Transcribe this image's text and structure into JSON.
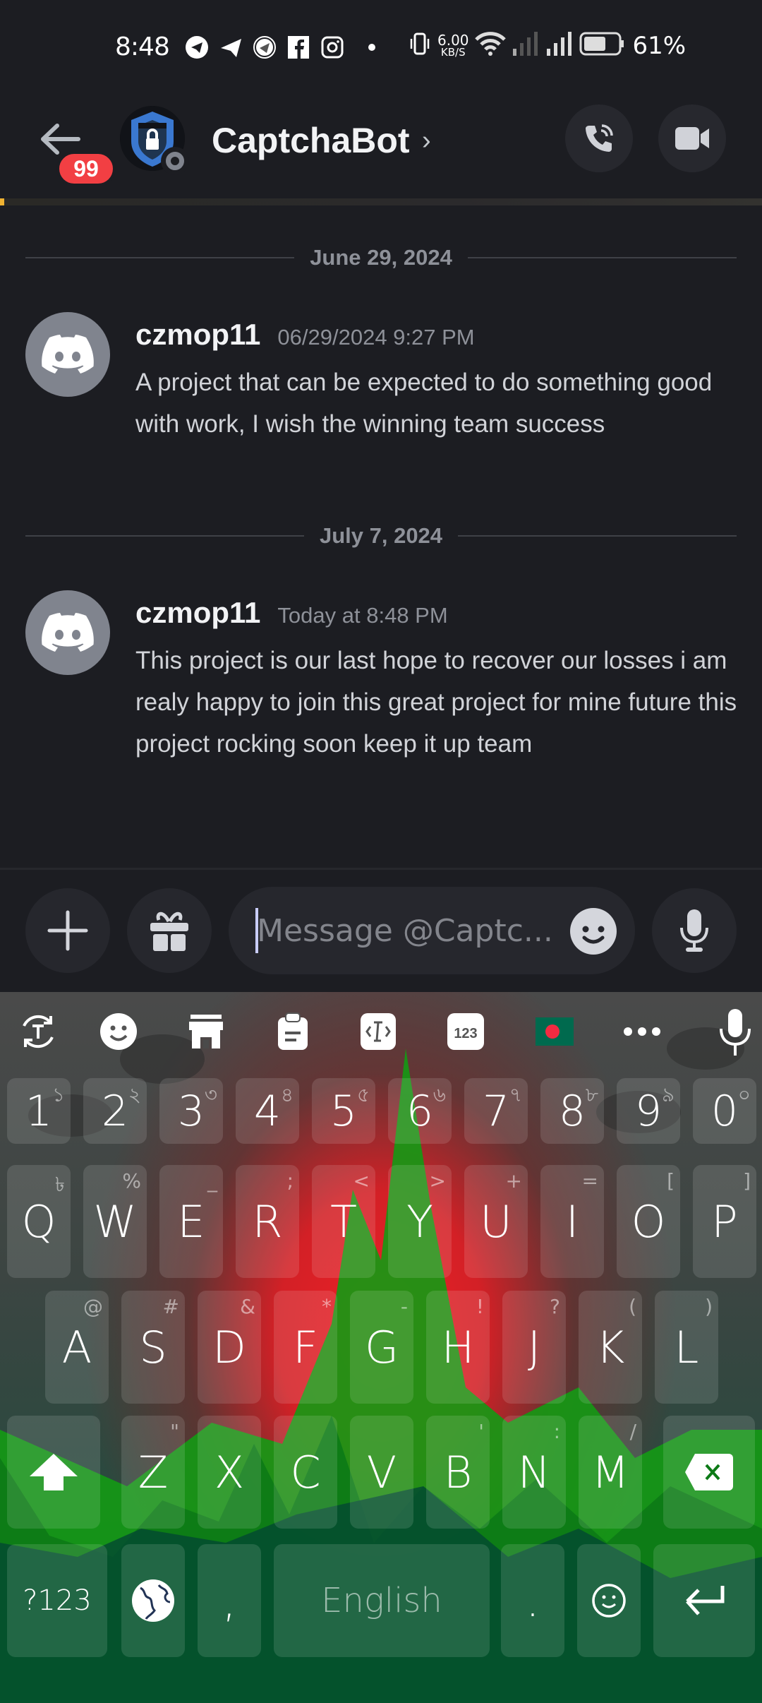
{
  "status_bar": {
    "time": "8:48",
    "notification_icons": [
      "telegram-circle-icon",
      "telegram-icon",
      "app-circle-icon",
      "facebook-icon",
      "instagram-icon",
      "more-dot-icon"
    ],
    "network_speed_value": "6.00",
    "network_speed_unit": "KB/S",
    "battery_percent": "61%",
    "battery_level": 0.61
  },
  "header": {
    "unread_count": "99",
    "channel_name": "CaptchaBot",
    "chevron": "›",
    "avatar_status": "offline",
    "progress_fraction": 0.006,
    "colors": {
      "badge": "#f23f43",
      "progress": "#f0b232"
    }
  },
  "messages": [
    {
      "date_divider": "June 29, 2024",
      "author": "czmop11",
      "timestamp": "06/29/2024 9:27 PM",
      "body": "A project that can be expected to do something good with work, I wish the winning team success"
    },
    {
      "date_divider": "July 7, 2024",
      "author": "czmop11",
      "timestamp": "Today at 8:48 PM",
      "body": "This project is our last hope to recover our losses i am realy happy to join this great project for mine future this project rocking soon keep it up team"
    }
  ],
  "composer": {
    "placeholder": "Message @Captc...",
    "value": ""
  },
  "keyboard": {
    "toolbar": [
      "translate-icon",
      "emoji-icon",
      "store-icon",
      "clipboard-icon",
      "text-edit-icon",
      "numpad-icon",
      "bangladesh-flag-icon",
      "more-icon",
      "voice-input-icon"
    ],
    "number_row": [
      {
        "main": "1",
        "hint": "১"
      },
      {
        "main": "2",
        "hint": "২"
      },
      {
        "main": "3",
        "hint": "৩"
      },
      {
        "main": "4",
        "hint": "৪"
      },
      {
        "main": "5",
        "hint": "৫"
      },
      {
        "main": "6",
        "hint": "৬"
      },
      {
        "main": "7",
        "hint": "৭"
      },
      {
        "main": "8",
        "hint": "৮"
      },
      {
        "main": "9",
        "hint": "৯"
      },
      {
        "main": "0",
        "hint": "০"
      }
    ],
    "row1": [
      {
        "main": "Q",
        "hint": "৳"
      },
      {
        "main": "W",
        "hint": "%"
      },
      {
        "main": "E",
        "hint": "_"
      },
      {
        "main": "R",
        "hint": ";"
      },
      {
        "main": "T",
        "hint": "<"
      },
      {
        "main": "Y",
        "hint": ">"
      },
      {
        "main": "U",
        "hint": "+"
      },
      {
        "main": "I",
        "hint": "="
      },
      {
        "main": "O",
        "hint": "["
      },
      {
        "main": "P",
        "hint": "]"
      }
    ],
    "row2": [
      {
        "main": "A",
        "hint": "@"
      },
      {
        "main": "S",
        "hint": "#"
      },
      {
        "main": "D",
        "hint": "&"
      },
      {
        "main": "F",
        "hint": "*"
      },
      {
        "main": "G",
        "hint": "-"
      },
      {
        "main": "H",
        "hint": "!"
      },
      {
        "main": "J",
        "hint": "?"
      },
      {
        "main": "K",
        "hint": "("
      },
      {
        "main": "L",
        "hint": ")"
      }
    ],
    "row3": [
      {
        "main": "Z",
        "hint": "\""
      },
      {
        "main": "X",
        "hint": ""
      },
      {
        "main": "C",
        "hint": ""
      },
      {
        "main": "V",
        "hint": ""
      },
      {
        "main": "B",
        "hint": "'"
      },
      {
        "main": "N",
        "hint": ":"
      },
      {
        "main": "M",
        "hint": "/"
      }
    ],
    "bottom_row": {
      "symbols": "?123",
      "comma": ",",
      "space": "English",
      "period": "."
    }
  }
}
